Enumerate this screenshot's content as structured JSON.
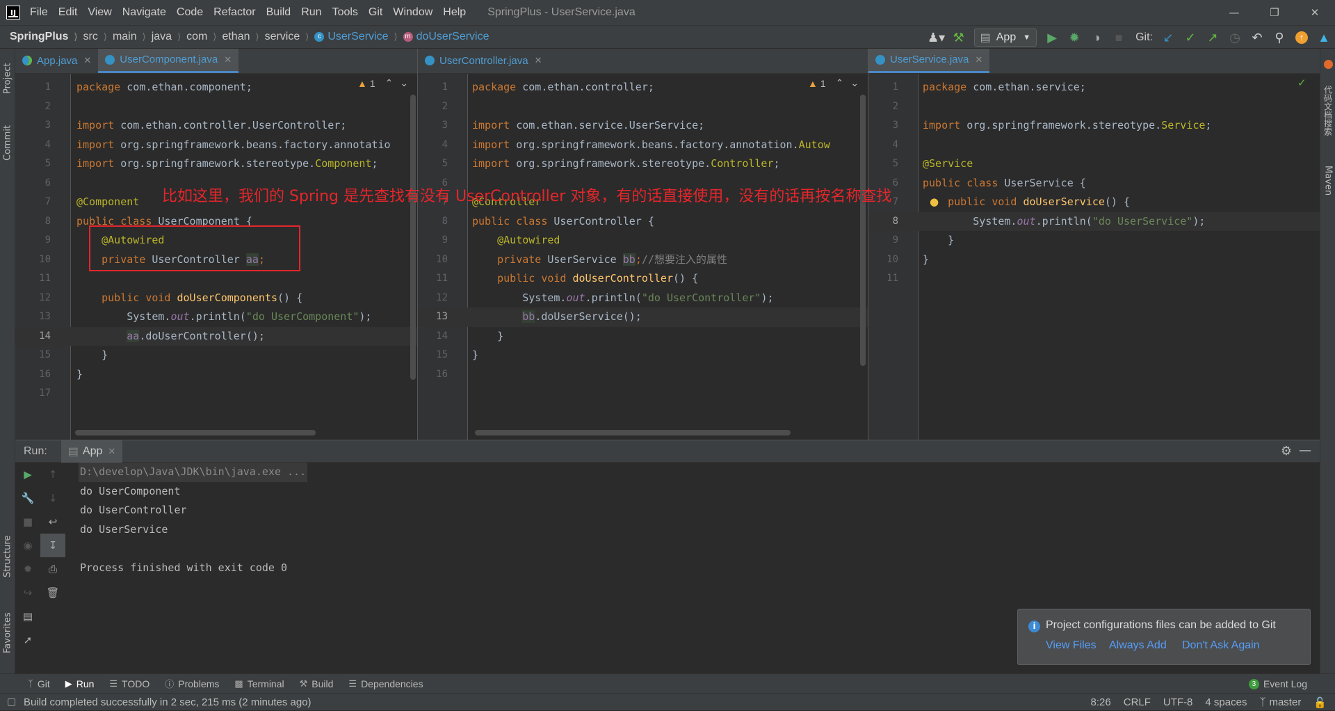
{
  "window": {
    "logo": "IJ",
    "title": "SpringPlus - UserService.java",
    "menu": [
      "File",
      "Edit",
      "View",
      "Navigate",
      "Code",
      "Refactor",
      "Build",
      "Run",
      "Tools",
      "Git",
      "Window",
      "Help"
    ]
  },
  "breadcrumbs": {
    "project": "SpringPlus",
    "items": [
      "src",
      "main",
      "java",
      "com",
      "ethan",
      "service"
    ],
    "class_name": "UserService",
    "method_name": "doUserService"
  },
  "toolbar": {
    "run_config": "App",
    "git_label": "Git:"
  },
  "left_strip": [
    "Project",
    "Commit",
    "Structure",
    "Favorites"
  ],
  "right_strip": [
    "代码文档搜索",
    "Maven"
  ],
  "editors": [
    {
      "tabs": [
        {
          "label": "App.java",
          "active": false,
          "icon": "app"
        },
        {
          "label": "UserComponent.java",
          "active": true,
          "icon": "class"
        }
      ],
      "warning_count": "1",
      "current_line": 14,
      "lines": [
        {
          "n": "1",
          "html": "<span class='kw'>package</span> <span class='pl'>com.ethan.component;</span>"
        },
        {
          "n": "2",
          "html": ""
        },
        {
          "n": "3",
          "html": "<span class='kw'>import</span> <span class='pl'>com.ethan.controller.UserController;</span>"
        },
        {
          "n": "4",
          "html": "<span class='kw'>import</span> <span class='pl'>org.springframework.beans.factory.annotatio</span>"
        },
        {
          "n": "5",
          "html": "<span class='kw'>import</span> <span class='pl'>org.springframework.stereotype.</span><span class='ann'>Component</span><span class='pl'>;</span>"
        },
        {
          "n": "6",
          "html": ""
        },
        {
          "n": "7",
          "html": "<span class='ann'>@Component</span>"
        },
        {
          "n": "8",
          "html": "<span class='kw'>public class</span> <span class='pl'>UserComponent {</span>"
        },
        {
          "n": "9",
          "html": "    <span class='ann'>@Autowired</span>"
        },
        {
          "n": "10",
          "html": "    <span class='kw'>private</span> <span class='pl'>UserController </span><span class='fieldhl'>aa</span><span class='kw'>;</span>"
        },
        {
          "n": "11",
          "html": ""
        },
        {
          "n": "12",
          "html": "    <span class='kw'>public void</span> <span class='fn'>doUserComponents</span><span class='pl'>() {</span>"
        },
        {
          "n": "13",
          "html": "        <span class='pl'>System.</span><span class='it'>out</span><span class='pl'>.println(</span><span class='str'>\"do UserComponent\"</span><span class='pl'>);</span>"
        },
        {
          "n": "14",
          "html": "        <span class='fieldhl'>aa</span><span class='pl'>.doUserController();</span>"
        },
        {
          "n": "15",
          "html": "    <span class='pl'>}</span>"
        },
        {
          "n": "16",
          "html": "<span class='pl'>}</span>"
        },
        {
          "n": "17",
          "html": ""
        }
      ]
    },
    {
      "tabs": [
        {
          "label": "UserController.java",
          "active": false,
          "icon": "class"
        }
      ],
      "warning_count": "1",
      "current_line": 13,
      "lines": [
        {
          "n": "1",
          "html": "<span class='kw'>package</span> <span class='pl'>com.ethan.controller;</span>"
        },
        {
          "n": "2",
          "html": ""
        },
        {
          "n": "3",
          "html": "<span class='kw'>import</span> <span class='pl'>com.ethan.service.UserService;</span>"
        },
        {
          "n": "4",
          "html": "<span class='kw'>import</span> <span class='pl'>org.springframework.beans.factory.annotation.</span><span class='ann'>Autow</span>"
        },
        {
          "n": "5",
          "html": "<span class='kw'>import</span> <span class='pl'>org.springframework.stereotype.</span><span class='ann'>Controller</span><span class='pl'>;</span>"
        },
        {
          "n": "6",
          "html": ""
        },
        {
          "n": "7",
          "html": "<span class='ann'>@Controller</span>"
        },
        {
          "n": "8",
          "html": "<span class='kw'>public class</span> <span class='pl'>UserController {</span>"
        },
        {
          "n": "9",
          "html": "    <span class='ann'>@Autowired</span>"
        },
        {
          "n": "10",
          "html": "    <span class='kw'>private</span> <span class='pl'>UserService </span><span class='fieldhl'>bb</span><span class='kw'>;</span><span class='cm'>//想要注入的属性</span>"
        },
        {
          "n": "11",
          "html": "    <span class='kw'>public void</span> <span class='fn'>doUserController</span><span class='pl'>() {</span>"
        },
        {
          "n": "12",
          "html": "        <span class='pl'>System.</span><span class='it'>out</span><span class='pl'>.println(</span><span class='str'>\"do UserController\"</span><span class='pl'>);</span>"
        },
        {
          "n": "13",
          "html": "        <span class='fieldhl'>bb</span><span class='pl'>.doUserService();</span>"
        },
        {
          "n": "14",
          "html": "    <span class='pl'>}</span>"
        },
        {
          "n": "15",
          "html": "<span class='pl'>}</span>"
        },
        {
          "n": "16",
          "html": ""
        }
      ]
    },
    {
      "tabs": [
        {
          "label": "UserService.java",
          "active": true,
          "icon": "class"
        }
      ],
      "warning_count": "",
      "current_line": 8,
      "lines": [
        {
          "n": "1",
          "html": "<span class='kw'>package</span> <span class='pl'>com.ethan.service;</span>"
        },
        {
          "n": "2",
          "html": ""
        },
        {
          "n": "3",
          "html": "<span class='kw'>import</span> <span class='pl'>org.springframework.stereotype.</span><span class='ann'>Service</span><span class='pl'>;</span>"
        },
        {
          "n": "4",
          "html": ""
        },
        {
          "n": "5",
          "html": "<span class='ann'>@Service</span>"
        },
        {
          "n": "6",
          "html": "<span class='kw'>public class</span> <span class='pl'>UserService {</span>"
        },
        {
          "n": "7",
          "html": "    <span class='kw'>public void</span> <span class='fn'>doUserService</span><span class='pl'>() {</span>"
        },
        {
          "n": "8",
          "html": "        <span class='pl'>System.</span><span class='it'>out</span><span class='pl'>.println(</span><span class='str'>\"do UserService\"</span><span class='pl'>);</span>"
        },
        {
          "n": "9",
          "html": "    <span class='pl'>}</span>"
        },
        {
          "n": "10",
          "html": "<span class='pl'>}</span>"
        },
        {
          "n": "11",
          "html": ""
        }
      ]
    }
  ],
  "annotation": {
    "text": "比如这里，我们的 Spring 是先查找有没有 UserController 对象，有的话直接使用，没有的话再按名称查找",
    "color": "#e4262b"
  },
  "run_panel": {
    "label": "Run:",
    "tab": "App",
    "console": [
      "D:\\develop\\Java\\JDK\\bin\\java.exe ...",
      "do UserComponent",
      "do UserController",
      "do UserService",
      "",
      "Process finished with exit code 0"
    ]
  },
  "notification": {
    "message": "Project configurations files can be added to Git",
    "links": [
      "View Files",
      "Always Add",
      "Don't Ask Again"
    ]
  },
  "bottom_tabs": [
    "Git",
    "Run",
    "TODO",
    "Problems",
    "Terminal",
    "Build",
    "Dependencies"
  ],
  "event_log": {
    "count": "3",
    "label": "Event Log"
  },
  "status": {
    "message": "Build completed successfully in 2 sec, 215 ms (2 minutes ago)",
    "position": "8:26",
    "line_sep": "CRLF",
    "encoding": "UTF-8",
    "indent": "4 spaces",
    "branch": "master"
  }
}
